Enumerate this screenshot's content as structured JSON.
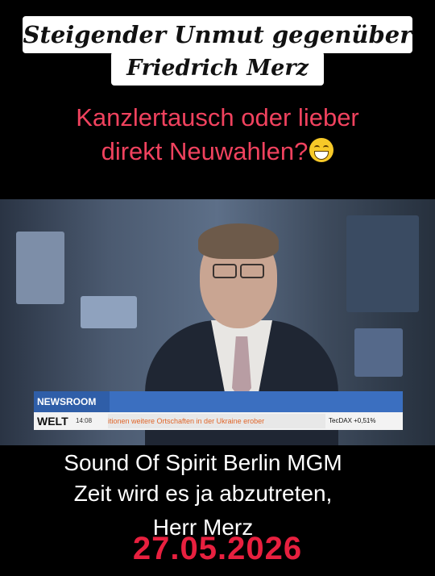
{
  "title": {
    "line1": "Steigender Unmut gegenüber",
    "line2": "Friedrich Merz"
  },
  "subtitle": {
    "line1": "Kanzlertausch oder lieber",
    "line2": "direkt Neuwahlen?",
    "emoji": "grinning-face-icon"
  },
  "video": {
    "channel_bar": "NEWSROOM",
    "logo": "WELT",
    "time": "14:08",
    "ticker": "itionen weitere Ortschaften in der Ukraine erober",
    "tecdax": "TecDAX +0,51%"
  },
  "caption": {
    "line1": "Sound Of Spirit Berlin MGM",
    "line2": "Zeit wird es ja abzutreten,",
    "line3": "Herr Merz",
    "date": "27.05.2026"
  },
  "colors": {
    "background": "#000000",
    "subtitle": "#f0425e",
    "date": "#e8203f",
    "caption": "#ffffff"
  }
}
